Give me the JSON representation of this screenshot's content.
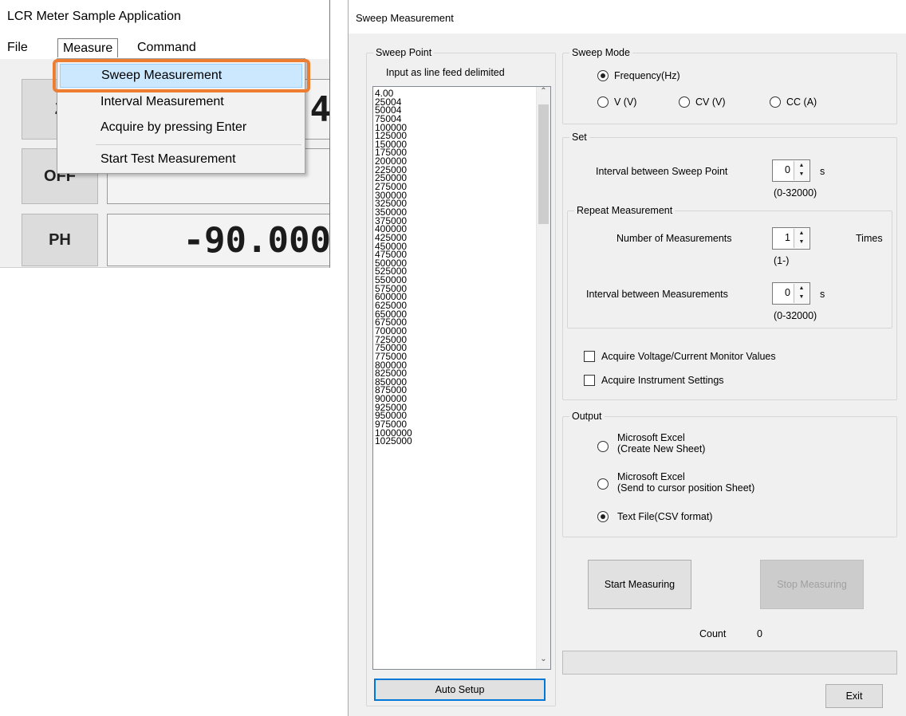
{
  "main_window": {
    "title": "LCR Meter Sample Application",
    "menus": [
      "File",
      "Measure",
      "Command"
    ],
    "buttons": {
      "z": "Z",
      "off": "OFF",
      "ph": "PH"
    },
    "readouts": {
      "z_value": "4",
      "ph_value": "-90.000"
    },
    "measure_menu": {
      "items": [
        "Sweep Measurement",
        "Interval Measurement",
        "Acquire by pressing Enter",
        "Start Test Measurement"
      ],
      "selected": "Sweep Measurement"
    },
    "highlight_color": "#ed7d31"
  },
  "sweep_dialog": {
    "title": "Sweep Measurement",
    "sweep_point": {
      "group_label": "Sweep Point",
      "hint": "Input as line feed delimited",
      "points": [
        "4.00",
        "25004",
        "50004",
        "75004",
        "100000",
        "125000",
        "150000",
        "175000",
        "200000",
        "225000",
        "250000",
        "275000",
        "300000",
        "325000",
        "350000",
        "375000",
        "400000",
        "425000",
        "450000",
        "475000",
        "500000",
        "525000",
        "550000",
        "575000",
        "600000",
        "625000",
        "650000",
        "675000",
        "700000",
        "725000",
        "750000",
        "775000",
        "800000",
        "825000",
        "850000",
        "875000",
        "900000",
        "925000",
        "950000",
        "975000",
        "1000000",
        "1025000"
      ],
      "auto_setup_label": "Auto Setup"
    },
    "sweep_mode": {
      "group_label": "Sweep Mode",
      "options": [
        "Frequency(Hz)",
        "V (V)",
        "CV (V)",
        "CC (A)"
      ],
      "selected": "Frequency(Hz)"
    },
    "set": {
      "group_label": "Set",
      "interval_sweep_label": "Interval between Sweep Point",
      "interval_sweep_value": "0",
      "interval_sweep_unit": "s",
      "interval_sweep_range": "(0-32000)",
      "repeat": {
        "group_label": "Repeat Measurement",
        "count_label": "Number of Measurements",
        "count_value": "1",
        "count_unit": "Times",
        "count_range": "(1-)",
        "interval_label": "Interval between Measurements",
        "interval_value": "0",
        "interval_unit": "s",
        "interval_range": "(0-32000)"
      },
      "check_monitor_label": "Acquire Voltage/Current Monitor Values",
      "check_monitor": false,
      "check_settings_label": "Acquire Instrument Settings",
      "check_settings": false
    },
    "output": {
      "group_label": "Output",
      "opt1_line1": "Microsoft Excel",
      "opt1_line2": "(Create New Sheet)",
      "opt2_line1": "Microsoft Excel",
      "opt2_line2": "(Send to cursor position Sheet)",
      "opt3": "Text File(CSV format)",
      "selected": "Text File(CSV format)"
    },
    "start_label": "Start Measuring",
    "stop_label": "Stop Measuring",
    "count_label": "Count",
    "count_value": "0",
    "progress": 0,
    "exit_label": "Exit"
  }
}
